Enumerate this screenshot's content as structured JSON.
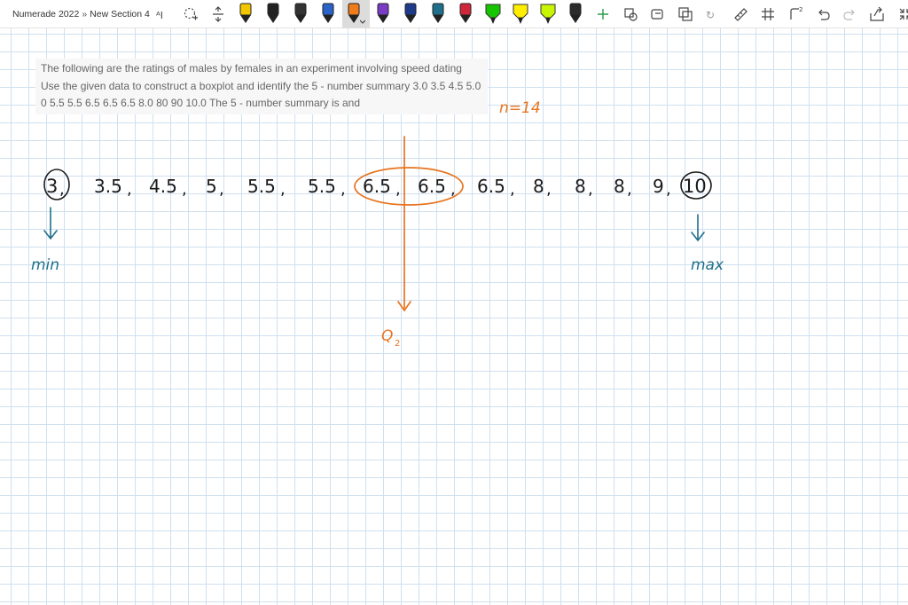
{
  "header": {
    "notebook": "Numerade 2022",
    "separator": "»",
    "section": "New Section 4"
  },
  "toolbar": {
    "tools": [
      {
        "name": "type-text-icon"
      },
      {
        "name": "lasso-select-icon"
      },
      {
        "name": "add-space-icon"
      },
      {
        "name": "pen-yellow-icon",
        "color": "#f2c700"
      },
      {
        "name": "pen-black-icon",
        "color": "#222222"
      },
      {
        "name": "pen-dark-icon",
        "color": "#333333"
      },
      {
        "name": "pen-blue-icon",
        "color": "#2a63c7"
      },
      {
        "name": "pen-orange-icon",
        "color": "#f07b1a",
        "active": true
      },
      {
        "name": "pen-purple-icon",
        "color": "#7a3cc7"
      },
      {
        "name": "pen-navy-icon",
        "color": "#1e3a8a"
      },
      {
        "name": "pen-teal-icon",
        "color": "#1e6f8a"
      },
      {
        "name": "pen-red-icon",
        "color": "#d0263a"
      },
      {
        "name": "highlighter-green-icon",
        "color": "#17c400"
      },
      {
        "name": "highlighter-yellow-icon",
        "color": "#ffee00"
      },
      {
        "name": "highlighter-lime-icon",
        "color": "#c8f500"
      },
      {
        "name": "pen-gray-icon",
        "color": "#2b2b2b"
      },
      {
        "name": "add-pen-icon"
      },
      {
        "name": "ink-to-shape-icon"
      },
      {
        "name": "ink-to-text-icon"
      },
      {
        "name": "ink-to-math-icon"
      },
      {
        "name": "replay-icon"
      },
      {
        "name": "ruler-icon"
      },
      {
        "name": "eraser-grid-icon"
      },
      {
        "name": "math-icon"
      },
      {
        "name": "undo-icon"
      },
      {
        "name": "redo-icon"
      },
      {
        "name": "convert-icon"
      },
      {
        "name": "collapse-icon"
      }
    ]
  },
  "question": {
    "text": "The following are the ratings of males by females in an experiment involving speed dating Use the given data to construct a boxplot and identify the 5 - number summary 3.0 3.5 4.5 5.0 0 5.5 5.5 6.5 6.5 6.5 8.0 80 90 10.0 The 5 - number summary is and"
  },
  "annotations": {
    "n_label": "n=14",
    "sequence": [
      "3",
      "3.5",
      "4.5",
      "5",
      "5.5",
      "5.5",
      "6.5",
      "6.5",
      "6.5",
      "8",
      "8",
      "8",
      "9",
      "10"
    ],
    "min_label": "min",
    "max_label": "max",
    "q2_label": "Q",
    "q2_sub": "2",
    "colors": {
      "black_ink": "#1a1a1a",
      "orange_ink": "#e8741e",
      "teal_ink": "#1e6f8a",
      "grid": "#cfe0f0"
    }
  }
}
